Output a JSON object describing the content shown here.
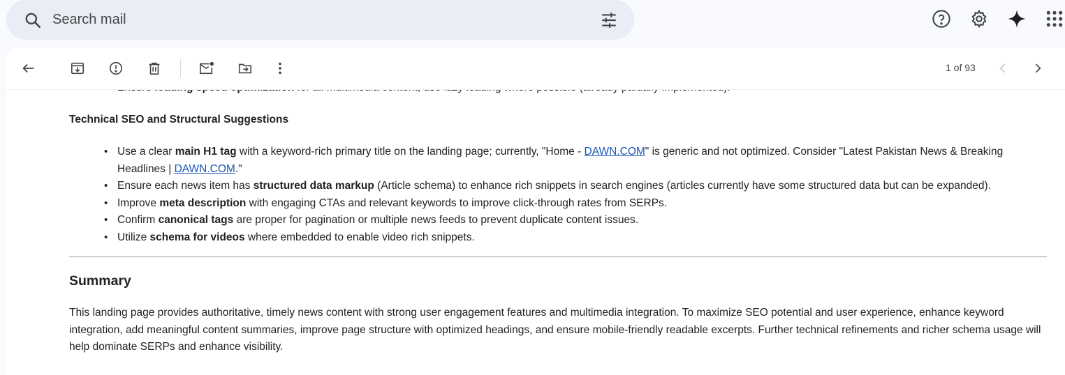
{
  "search": {
    "placeholder": "Search mail"
  },
  "header_icons": [
    "search-icon",
    "tune-icon",
    "help-icon",
    "settings-icon",
    "gemini-sparkle-icon",
    "apps-grid-icon"
  ],
  "toolbar": {
    "icons": [
      "back-arrow-icon",
      "archive-icon",
      "report-spam-icon",
      "delete-icon",
      "mark-unread-icon",
      "move-to-icon",
      "more-vert-icon",
      "prev-chevron-icon",
      "next-chevron-icon"
    ],
    "pager_text": "1 of 93"
  },
  "email": {
    "clipped_line": {
      "pre": "Ensure ",
      "bold": "loading speed optimization",
      "post": " for all multimedia content; use lazy loading where possible (already partially implemented)."
    },
    "section_heading": "Technical SEO and Structural Suggestions",
    "bullets": [
      {
        "pre": "Use a clear ",
        "bold": "main H1 tag",
        "mid": " with a keyword-rich primary title on the landing page; currently, \"Home - ",
        "link1": "DAWN.COM",
        "mid2": "\" is generic and not optimized. Consider \"Latest Pakistan News & Breaking Headlines | ",
        "link2": "DAWN.COM",
        "post": ".\""
      },
      {
        "pre": "Ensure each news item has ",
        "bold": "structured data markup",
        "post": " (Article schema) to enhance rich snippets in search engines (articles currently have some structured data but can be expanded)."
      },
      {
        "pre": "Improve ",
        "bold": "meta description",
        "post": " with engaging CTAs and relevant keywords to improve click-through rates from SERPs."
      },
      {
        "pre": "Confirm ",
        "bold": "canonical tags",
        "post": " are proper for pagination or multiple news feeds to prevent duplicate content issues."
      },
      {
        "pre": "Utilize ",
        "bold": "schema for videos",
        "post": " where embedded to enable video rich snippets."
      }
    ],
    "summary_heading": "Summary",
    "summary_text": "This landing page provides authoritative, timely news content with strong user engagement features and multimedia integration. To maximize SEO potential and user experience, enhance keyword integration, add meaningful content summaries, improve page structure with optimized headings, and ensure mobile-friendly readable excerpts. Further technical refinements and richer schema usage will help dominate SERPs and enhance visibility."
  },
  "colors": {
    "page_bg": "#f8fafd",
    "search_bg": "#e9eef6",
    "link": "#1a56b5",
    "icon": "#444746"
  }
}
